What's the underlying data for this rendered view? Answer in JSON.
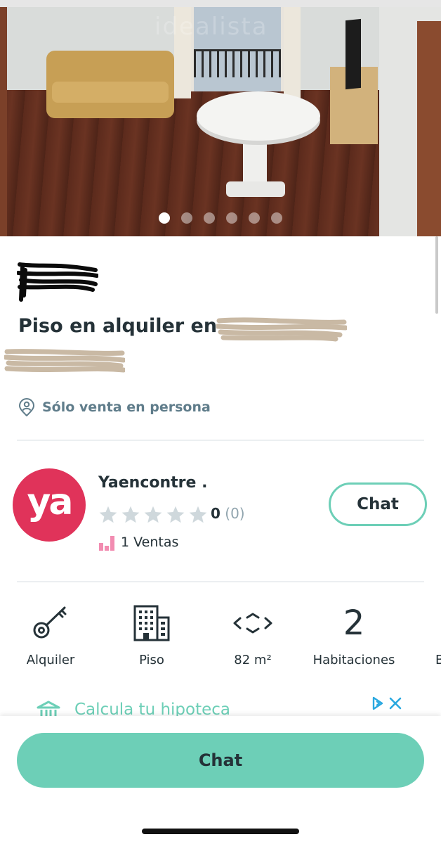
{
  "carousel": {
    "watermark": "idealista",
    "photo_count": 6,
    "active_index": 0
  },
  "listing": {
    "title": "Piso en alquiler en",
    "in_person_label": "Sólo venta en persona"
  },
  "seller": {
    "avatar_text": "ya",
    "avatar_color": "#e0335a",
    "name": "Yaencontre .",
    "stars_filled": 0,
    "rating_value": "0",
    "rating_count": "(0)",
    "sales_label": "1 Ventas",
    "chat_label": "Chat"
  },
  "attributes": [
    {
      "icon": "key-icon",
      "label": "Alquiler"
    },
    {
      "icon": "building-icon",
      "label": "Piso"
    },
    {
      "icon": "area-icon",
      "label": "82 m²"
    },
    {
      "value": "2",
      "label": "Habitaciones"
    },
    {
      "label": "B"
    }
  ],
  "ad": {
    "icon": "bank-icon",
    "text": "Calcula tu hipoteca"
  },
  "bottom": {
    "chat_label": "Chat"
  },
  "colors": {
    "accent": "#6dcfb7",
    "text_primary": "#253238",
    "text_secondary": "#607d8b",
    "star_empty": "#cfd8dc",
    "sales_icon": "#f28cb1"
  }
}
